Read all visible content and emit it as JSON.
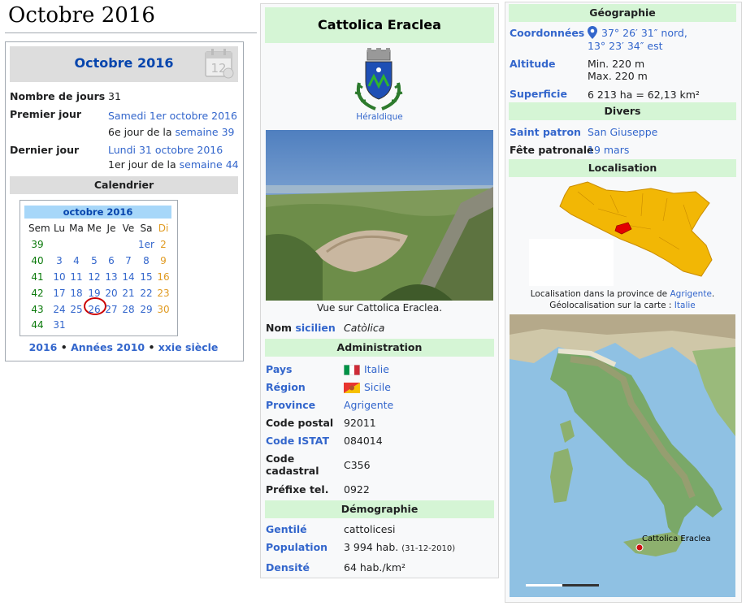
{
  "page": {
    "heading": "Octobre 2016"
  },
  "month_box": {
    "title": "Octobre 2016",
    "rows": [
      {
        "label": "Nombre de jours",
        "value": "31"
      },
      {
        "label": "Premier jour",
        "line1_link": "Samedi 1er octobre 2016",
        "line2_prefix": "6e jour de la ",
        "line2_link": "semaine 39"
      },
      {
        "label": "Dernier jour",
        "line1_link": "Lundi 31 octobre 2016",
        "line2_prefix": "1er jour de la ",
        "line2_link": "semaine 44"
      }
    ],
    "calendar_heading": "Calendrier",
    "calendar": {
      "title": "octobre 2016",
      "headers": [
        "Sem",
        "Lu",
        "Ma",
        "Me",
        "Je",
        "Ve",
        "Sa",
        "Di"
      ],
      "weeks": [
        [
          "39",
          "",
          "",
          "",
          "",
          "",
          "1er",
          "2"
        ],
        [
          "40",
          "3",
          "4",
          "5",
          "6",
          "7",
          "8",
          "9"
        ],
        [
          "41",
          "10",
          "11",
          "12",
          "13",
          "14",
          "15",
          "16"
        ],
        [
          "42",
          "17",
          "18",
          "19",
          "20",
          "21",
          "22",
          "23"
        ],
        [
          "43",
          "24",
          "25",
          "26",
          "27",
          "28",
          "29",
          "30"
        ],
        [
          "44",
          "31",
          "",
          "",
          "",
          "",
          "",
          ""
        ]
      ],
      "highlighted_day": "26"
    },
    "footer": {
      "year": "2016",
      "sep1": " • ",
      "decade": "Années 2010",
      "sep2": " • ",
      "century": "xxie siècle"
    }
  },
  "infobox": {
    "title": "Cattolica Eraclea",
    "heraldique": "Héraldique",
    "photo_caption": "Vue sur Cattolica Eraclea.",
    "nom": {
      "label": "Nom",
      "label_link": "sicilien",
      "value": "Catòlica"
    },
    "administration": {
      "heading": "Administration",
      "rows": [
        {
          "label": "Pays",
          "value": "Italie",
          "link": true,
          "flag": "italy"
        },
        {
          "label": "Région",
          "value": "Sicile",
          "link": true,
          "flag": "sicily"
        },
        {
          "label": "Province",
          "value": "Agrigente",
          "link": true
        },
        {
          "label": "Code postal",
          "value": "92011",
          "link": false
        },
        {
          "label": "Code ISTAT",
          "value": "084014",
          "link": false
        },
        {
          "label": "Code cadastral",
          "value": "C356",
          "link": false
        },
        {
          "label": "Préfixe tel.",
          "value": "0922",
          "link": false
        }
      ]
    },
    "demographie": {
      "heading": "Démographie",
      "rows": [
        {
          "label": "Gentilé",
          "value": "cattolicesi",
          "note": ""
        },
        {
          "label": "Population",
          "value": "3 994 hab.",
          "note": "(31-12-2010)"
        },
        {
          "label": "Densité",
          "value": "64 hab./km²",
          "note": ""
        }
      ]
    }
  },
  "right_box": {
    "geographie_heading": "Géographie",
    "coordonnees": {
      "label": "Coordonnées",
      "line1": "37° 26′ 31″ nord,",
      "line2": "13° 23′ 34″ est"
    },
    "altitude": {
      "label": "Altitude",
      "min": "Min. 220 m",
      "max": "Max. 220 m"
    },
    "superficie": {
      "label": "Superficie",
      "value": "6 213 ha = 62,13 km²"
    },
    "divers_heading": "Divers",
    "saint_patron": {
      "label": "Saint patron",
      "value": "San Giuseppe"
    },
    "fete": {
      "label": "Fête patronale",
      "value": "19 mars"
    },
    "localisation_heading": "Localisation",
    "loc_caption1_prefix": "Localisation dans la province de ",
    "loc_caption1_link": "Agrigente",
    "loc_caption1_suffix": ".",
    "loc_caption2_prefix": "Géolocalisation sur la carte : ",
    "loc_caption2_link": "Italie",
    "map_marker_label": "Cattolica Eraclea"
  },
  "colors": {
    "link": "#3366cc",
    "section_bg": "#d5f5d5",
    "week_num": "#0b7a0b",
    "weekend": "#e09b23",
    "highlight": "#cc0000"
  }
}
